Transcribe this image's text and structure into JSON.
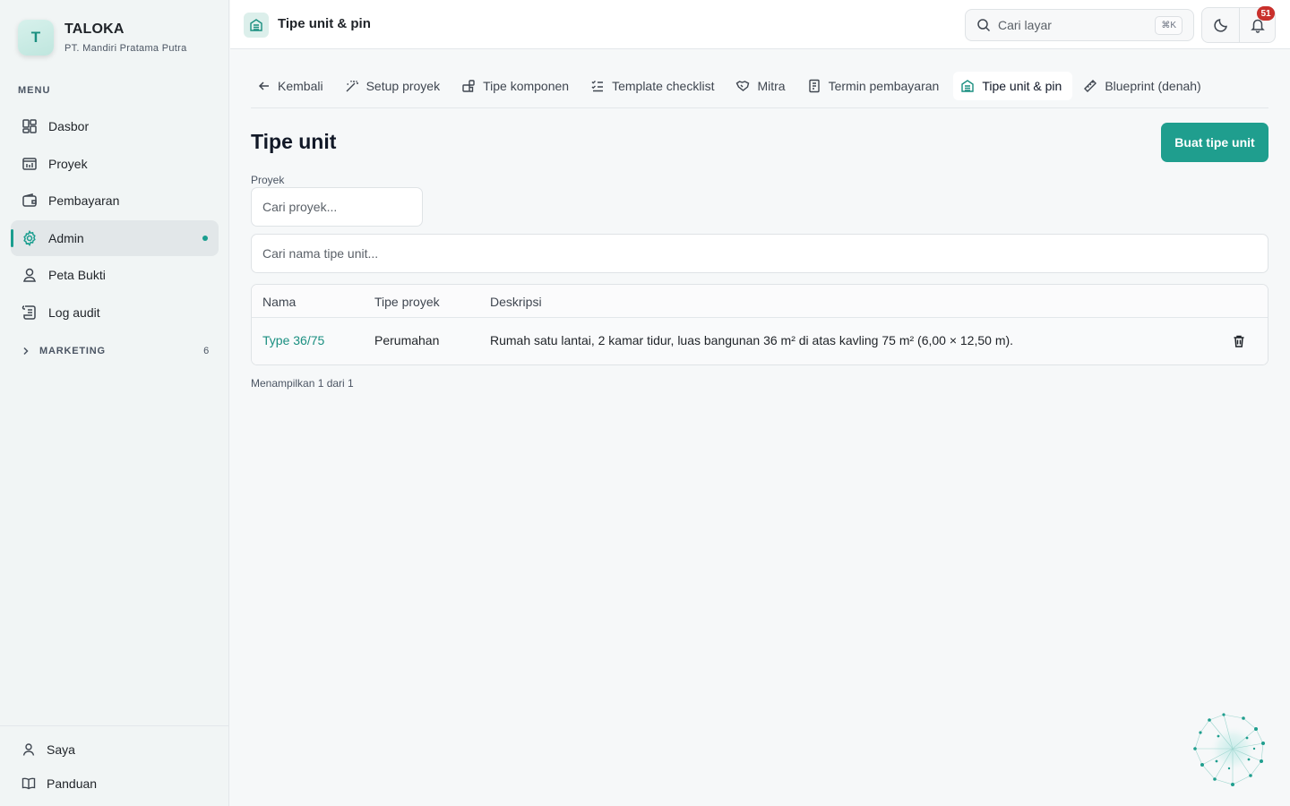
{
  "brand": {
    "initial": "T",
    "name": "TALOKA",
    "org": "PT. Mandiri Pratama Putra"
  },
  "sidebar": {
    "menu_label": "MENU",
    "items": [
      {
        "label": "Dasbor",
        "icon": "dashboard-icon"
      },
      {
        "label": "Proyek",
        "icon": "project-icon"
      },
      {
        "label": "Pembayaran",
        "icon": "wallet-icon"
      },
      {
        "label": "Admin",
        "icon": "gear-icon",
        "active": true
      },
      {
        "label": "Peta Bukti",
        "icon": "map-pin-user-icon"
      },
      {
        "label": "Log audit",
        "icon": "scroll-icon"
      }
    ],
    "section": {
      "label": "MARKETING",
      "count": "6"
    },
    "bottom": [
      {
        "label": "Saya",
        "icon": "user-icon"
      },
      {
        "label": "Panduan",
        "icon": "book-icon"
      }
    ]
  },
  "topbar": {
    "title": "Tipe unit & pin",
    "search_placeholder": "Cari layar",
    "shortcut": "⌘K",
    "notifications": "51"
  },
  "tabs": [
    {
      "label": "Kembali",
      "icon": "arrow-left-icon"
    },
    {
      "label": "Setup proyek",
      "icon": "magic-wand-icon"
    },
    {
      "label": "Tipe komponen",
      "icon": "components-icon"
    },
    {
      "label": "Template checklist",
      "icon": "checklist-icon"
    },
    {
      "label": "Mitra",
      "icon": "handshake-icon"
    },
    {
      "label": "Termin pembayaran",
      "icon": "receipt-icon"
    },
    {
      "label": "Tipe unit & pin",
      "icon": "building-icon",
      "active": true
    },
    {
      "label": "Blueprint (denah)",
      "icon": "ruler-icon"
    }
  ],
  "main": {
    "title": "Tipe unit",
    "create_button": "Buat tipe unit",
    "project_label": "Proyek",
    "project_placeholder": "Cari proyek...",
    "name_placeholder": "Cari nama tipe unit...",
    "table": {
      "columns": [
        "Nama",
        "Tipe proyek",
        "Deskripsi"
      ],
      "rows": [
        {
          "name": "Type 36/75",
          "project_type": "Perumahan",
          "description": "Rumah satu lantai, 2 kamar tidur, luas bangunan 36 m² di atas kavling 75 m² (6,00 × 12,50 m)."
        }
      ]
    },
    "showing": "Menampilkan 1 dari 1"
  },
  "colors": {
    "accent": "#1f9e8e",
    "badge": "#c9302c"
  }
}
